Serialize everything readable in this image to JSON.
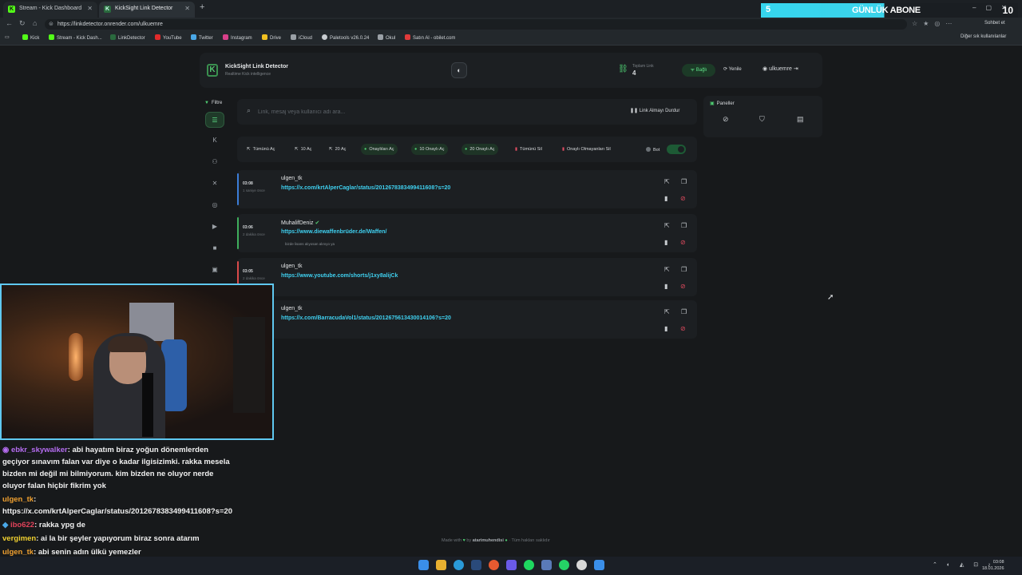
{
  "browser": {
    "tabs": [
      {
        "label": "Stream - Kick Dashboard",
        "active": false
      },
      {
        "label": "KickSight Link Detector",
        "active": true
      }
    ],
    "url": "https://linkdetector.onrender.com/ulkuemre",
    "profile_label": "Sohbet et",
    "bookmarks": [
      "Kick",
      "Stream - Kick Dash...",
      "LinkDetector",
      "YouTube",
      "Twitter",
      "Instagram",
      "Drive",
      "iCloud",
      "Paletools v26.0.24",
      "Okul",
      "Satın Al - obilet.com"
    ],
    "other_bookmarks": "Diğer sık kullanılanlar"
  },
  "overlay": {
    "abone_left": "5",
    "abone_label": "GÜNLÜK ABONE",
    "abone_count": "10"
  },
  "app": {
    "title": "KickSight Link Detector",
    "subtitle": "Realtime Kick intelligence",
    "total_label": "Toplam Link",
    "total_value": "4",
    "connected_label": "Bağlı",
    "refresh_label": "Yenile",
    "username": "ulkuemre",
    "filter_label": "Filtre",
    "search_placeholder": "Link, mesaj veya kullanıcı adı ara...",
    "stop_label": "Link Almayı Durdur",
    "panels_label": "Paneller",
    "actions": [
      {
        "label": "Tümünü Aç",
        "style": "plain"
      },
      {
        "label": "10 Aç",
        "style": "plain"
      },
      {
        "label": "20 Aç",
        "style": "plain"
      },
      {
        "label": "Onaylıları Aç",
        "style": "green"
      },
      {
        "label": "10 Onaylı Aç",
        "style": "green"
      },
      {
        "label": "20 Onaylı Aç",
        "style": "green"
      },
      {
        "label": "Tümünü Sil",
        "style": "red"
      },
      {
        "label": "Onaylı Olmayanları Sil",
        "style": "red"
      }
    ],
    "bot_label": "Bot",
    "bot_enabled": true,
    "links": [
      {
        "time": "03:08",
        "ago": "1 saniye önce",
        "user": "ulgen_tk",
        "verified": false,
        "url": "https://x.com/krtAlperCaglar/status/2012678383499411608?s=20",
        "message": "",
        "accent": "#3b7dd8"
      },
      {
        "time": "03:06",
        "ago": "2 dakika önce",
        "user": "MuhalifDeniz",
        "verified": true,
        "url": "https://www.diewaffenbrüder.de/Waffen/",
        "message": "bizde lisans alıyosan alınıyo ya",
        "accent": "#3fae5c"
      },
      {
        "time": "03:05",
        "ago": "2 dakika önce",
        "user": "ulgen_tk",
        "verified": false,
        "url": "https://www.youtube.com/shorts/j1xy8alijCk",
        "message": "",
        "accent": "#d94a4a"
      },
      {
        "time": "",
        "ago": "",
        "user": "ulgen_tk",
        "verified": false,
        "url": "https://x.com/BarracudaVol1/status/2012675613430014106?s=20",
        "message": "",
        "accent": "#3b7dd8"
      }
    ],
    "footer_made_with": "Made with",
    "footer_by": "by",
    "footer_author": "atarimuhendisi",
    "footer_rights": "· Tüm hakları saklıdır"
  },
  "chat": [
    {
      "user": "ebkr_skywalker",
      "color": "#b46cf0",
      "text": ": abi hayatım biraz yoğun dönemlerden geçiyor sınavım falan var diye o kadar ilgisizimki. rakka mesela bizden mi değil mi bilmiyorum. kim bizden ne oluyor nerde oluyor falan hiçbir fikrim yok"
    },
    {
      "user": "ulgen_tk",
      "color": "#f0a030",
      "text": ": https://x.com/krtAlperCaglar/status/2012678383499411608?s=20"
    },
    {
      "user": "ibo622",
      "color": "#e0425a",
      "text": ": rakka ypg de"
    },
    {
      "user": "vergimen",
      "color": "#f0d030",
      "text": ": ai la bir şeyler yapıyorum biraz sonra atarım"
    },
    {
      "user": "ulgen_tk",
      "color": "#f0a030",
      "text": ": abi senin adın ülkü yemezler"
    }
  ],
  "taskbar": {
    "time": "03:08",
    "date": "18.01.2026"
  }
}
